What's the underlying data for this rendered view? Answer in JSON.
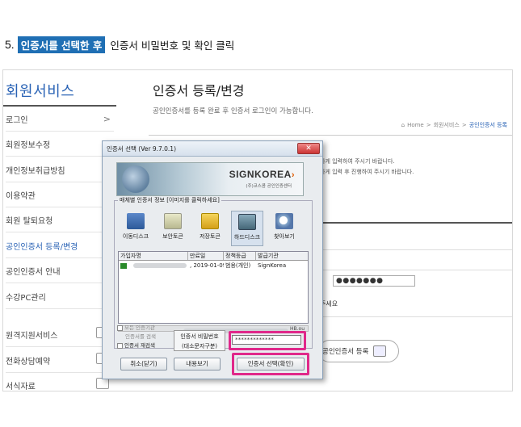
{
  "step": {
    "number": "5.",
    "highlight": "인증서를 선택한 후",
    "rest": "인증서 비밀번호 및 확인 클릭"
  },
  "sidebar": {
    "title": "회원서비스",
    "items": [
      {
        "label": "로그인",
        "active": false
      },
      {
        "label": "회원정보수정",
        "active": false
      },
      {
        "label": "개인정보취급방침",
        "active": false
      },
      {
        "label": "이용약관",
        "active": false
      },
      {
        "label": "회원 탈퇴요청",
        "active": false
      },
      {
        "label": "공인인증서 등록/변경",
        "active": true
      },
      {
        "label": "공인인증서 안내",
        "active": false
      },
      {
        "label": "수강PC관리",
        "active": false
      },
      {
        "label": "원격지원서비스",
        "active": false
      },
      {
        "label": "전화상담예약",
        "active": false
      },
      {
        "label": "서식자료",
        "active": false
      }
    ],
    "chevron": ">"
  },
  "main": {
    "title": "인증서 등록/변경",
    "desc": "공인인증서를 등록 완료 후 인증서 로그인이 가능합니다.",
    "breadcrumb": [
      "Home",
      ">",
      "회원서비스",
      ">",
      "공인인증서 등록"
    ],
    "bg_line1": "하게 입력하여 주시기 바랍니다.",
    "bg_line2": "하게 입력 후 진행하여 주시기 바랍니다.",
    "password_dots": "●●●●●●●",
    "save_label": "주세요",
    "register_button": "공인인증서 등록"
  },
  "dialog": {
    "title": "인증서 선택 (Ver 9.7.0.1)",
    "brand": "SIGNKOREA",
    "brand_sub": "(주)코스콤 공인인증센터",
    "group_label": "매체별 인증서 정보 [이미지를 클릭하세요]",
    "media": [
      {
        "label": "이동디스크",
        "icon": "usb-drive-icon"
      },
      {
        "label": "보안토큰",
        "icon": "security-token-icon"
      },
      {
        "label": "저장토큰",
        "icon": "storage-token-icon"
      },
      {
        "label": "하드디스크",
        "icon": "hard-disk-icon"
      },
      {
        "label": "찾아보기",
        "icon": "browse-icon"
      }
    ],
    "columns": [
      "가입자명",
      "만료일",
      "정책등급",
      "발급기관"
    ],
    "rows": [
      {
        "name": "",
        "expiry": ", 2019-01-09",
        "policy": "범용(개인)",
        "issuer": "SignKorea"
      }
    ],
    "scroll_text": "HB.ou",
    "opt_all": "모든 인증기관",
    "opt_search": "인증서를 검색",
    "opt_research": "인증서 재검색",
    "pw_label": "인증서 비밀번호",
    "pw_hint": "(대소문자구분)",
    "pw_value": "*************",
    "btn_cancel": "취소(닫기)",
    "btn_view": "내용보기",
    "btn_ok": "인증서 선택(확인)",
    "highlight_color": "#e0288a"
  }
}
